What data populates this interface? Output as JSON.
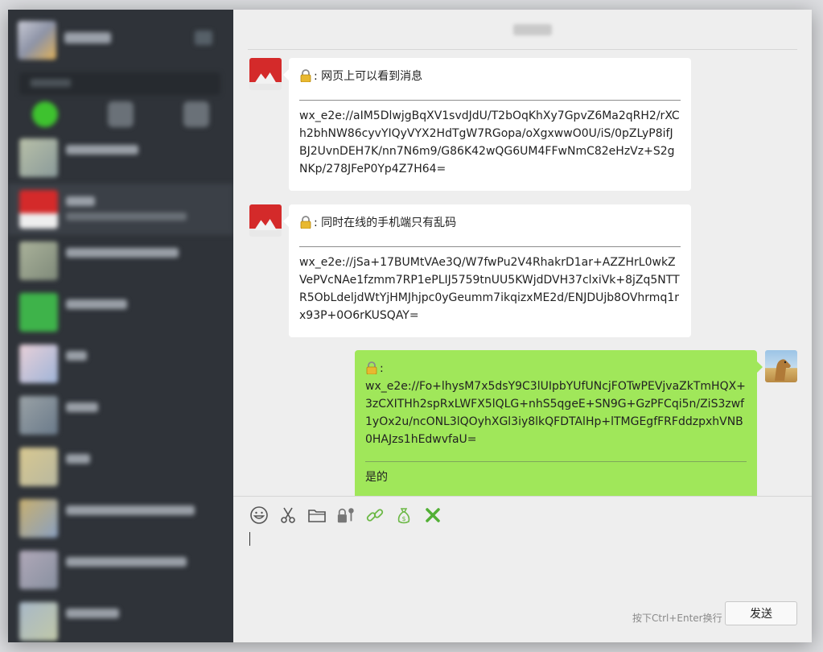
{
  "messages": [
    {
      "sender": "other",
      "lines": [
        "网页上可以看到消息"
      ],
      "encrypted": "wx_e2e://aIM5DlwjgBqXV1svdJdU/T2bOqKhXy7GpvZ6Ma2qRH2/rXCh2bhNW86cyvYIQyVYX2HdTgW7RGopa/oXgxwwO0U/iS/0pZLyP8ifJBJ2UvnDEH7K/nn7N6m9/G86K42wQG6UM4FFwNmC82eHzVz+S2gNKp/278JFeP0Yp4Z7H64="
    },
    {
      "sender": "other",
      "lines": [
        "同时在线的手机端只有乱码"
      ],
      "encrypted": "wx_e2e://jSa+17BUMtVAe3Q/W7fwPu2V4RhakrD1ar+AZZHrL0wkZVePVcNAe1fzmm7RP1ePLIJ5759tnUU5KWjdDVH37clxiVk+8jZq5NTTR5ObLdeljdWtYjHMJhjpc0yGeumm7ikqizxME2d/ENJDUjb8OVhrmq1rx93P+0O6rKUSQAY="
    },
    {
      "sender": "me",
      "encrypted": "wx_e2e://Fo+lhysM7x5dsY9C3lUIpbYUfUNcjFOTwPEVjvaZkTmHQX+3zCXITHh2spRxLWFX5lQLG+nhS5qgeE+SN9G+GzPFCqi5n/ZiS3zwf1yOx2u/ncONL3lQOyhXGl3iy8lkQFDTAlHp+lTMGEgfFRFddzpxhVNB0HAJzs1hEdwvfaU=",
      "reply": "是的"
    }
  ],
  "lock_prefix": ":",
  "toolbar": {
    "icons": [
      "emoji-icon",
      "scissors-icon",
      "folder-icon",
      "lock-key-icon",
      "link-icon",
      "money-bag-icon",
      "close-x-icon"
    ]
  },
  "input": {
    "hint": "按下Ctrl+Enter换行",
    "send_label": "发送"
  },
  "colors": {
    "my_bubble": "#a0e75a",
    "other_bubble": "#ffffff",
    "sidebar": "#2f3339",
    "accent_green": "#52b035"
  }
}
